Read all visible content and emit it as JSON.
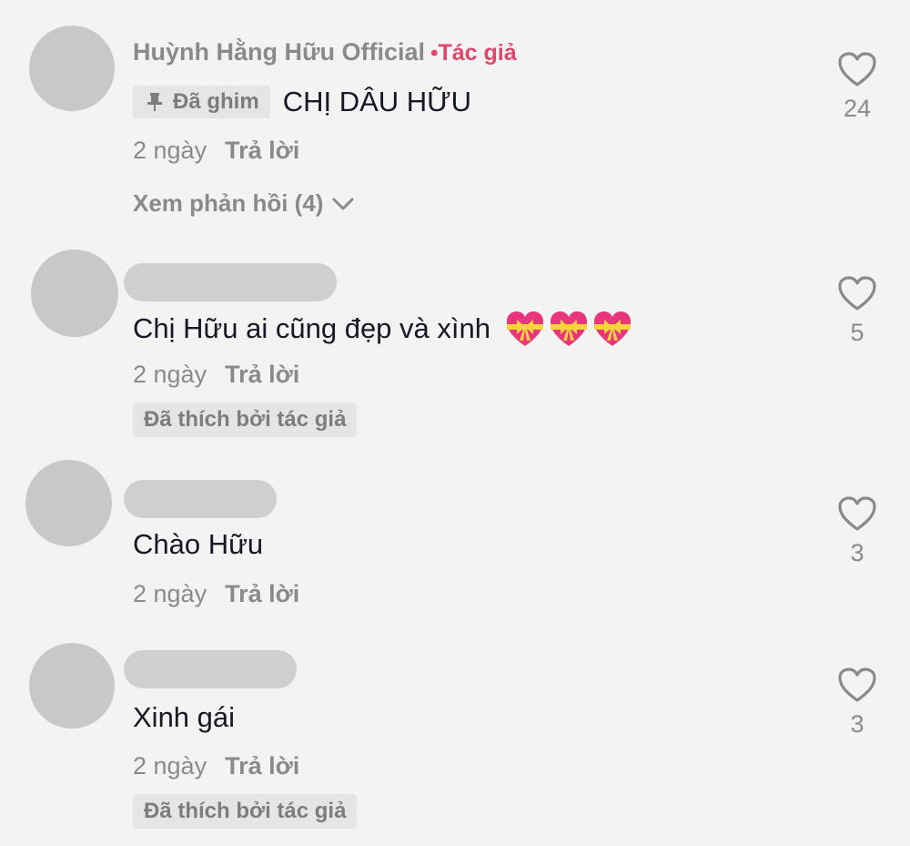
{
  "comments": [
    {
      "username": "Huỳnh Hằng Hữu Official",
      "author_tag": "Tác giả",
      "pinned_label": "Đã ghim",
      "text": "CHỊ DÂU HỮU",
      "time": "2 ngày",
      "reply": "Trả lời",
      "view_replies": "Xem phản hồi (4)",
      "likes": "24"
    },
    {
      "text": "Chị Hữu ai cũng đẹp và xình",
      "emojis": [
        "heart-with-ribbon",
        "heart-with-ribbon",
        "heart-with-ribbon"
      ],
      "time": "2 ngày",
      "reply": "Trả lời",
      "liked_by_author": "Đã thích bởi tác giả",
      "likes": "5"
    },
    {
      "text": "Chào Hữu",
      "time": "2 ngày",
      "reply": "Trả lời",
      "likes": "3"
    },
    {
      "text": "Xinh gái",
      "time": "2 ngày",
      "reply": "Trả lời",
      "liked_by_author": "Đã thích bởi tác giả",
      "likes": "3"
    }
  ],
  "colors": {
    "background": "#f4f3f3",
    "author_accent": "#e0456b",
    "muted_text": "#8a8a8a",
    "body_text": "#161823"
  }
}
